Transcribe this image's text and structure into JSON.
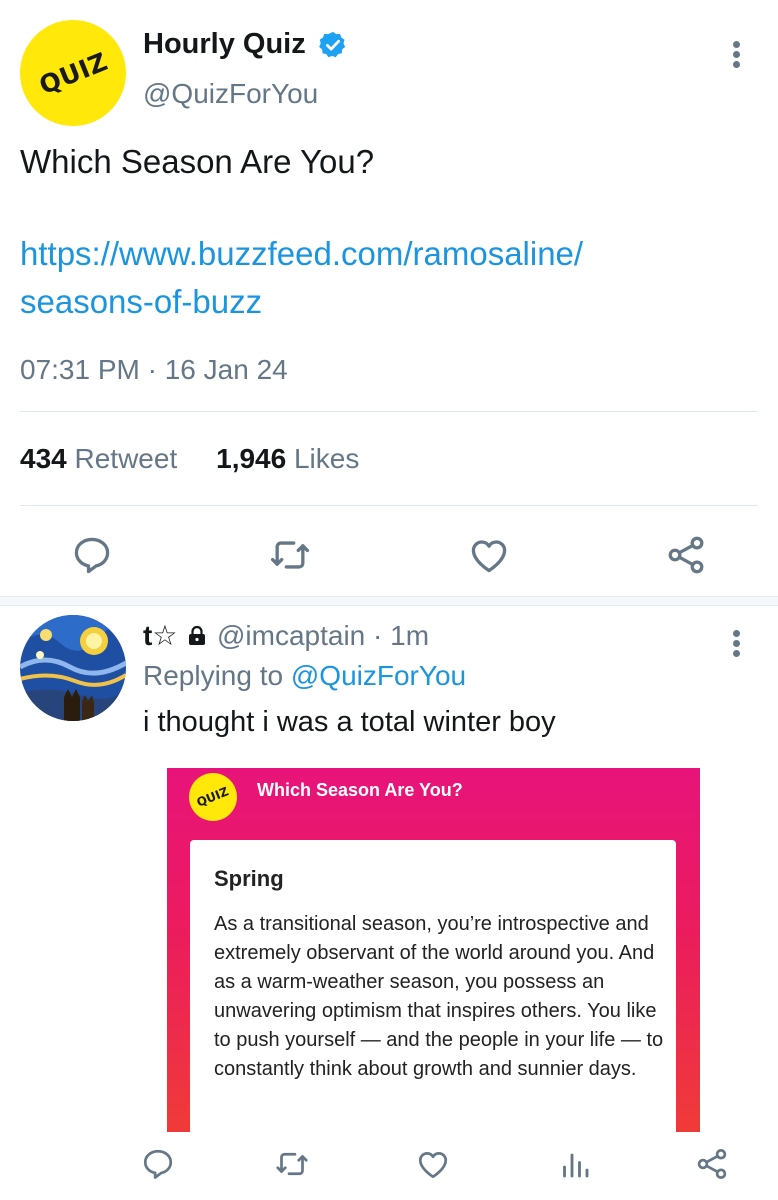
{
  "tweet": {
    "avatar_text": "QUIZ",
    "display_name": "Hourly Quiz",
    "handle": "@QuizForYou",
    "text": "Which Season Are You?",
    "link_line1": "https://www.buzzfeed.com/ramosaline/",
    "link_line2": "seasons-of-buzz",
    "timestamp": "07:31 PM · 16 Jan 24",
    "retweet_count": "434",
    "retweet_label": "Retweet",
    "like_count": "1,946",
    "like_label": "Likes"
  },
  "reply": {
    "name": "t☆",
    "handle": "@imcaptain",
    "time": "· 1m",
    "replying_prefix": "Replying to",
    "replying_handle": "@QuizForYou",
    "text": "i thought i was a total winter boy",
    "card": {
      "logo_text": "QUIZ",
      "title": "Which Season Are You?",
      "result_title": "Spring",
      "result_body": "As a transitional season, you’re introspective and extremely observant of the world around you. And as a warm-weather season, you possess an unwavering optimism that inspires others. You like to push yourself — and the people in your life — to constantly think about growth and sunnier days."
    }
  },
  "colors": {
    "accent": "#1b95e0",
    "muted": "#657786",
    "verified": "#1da1f2",
    "quiz_yellow": "#ffe80a",
    "card_pink": "#e8137a",
    "card_red": "#ef3b38"
  },
  "icons": {
    "actions": [
      "reply-icon",
      "retweet-icon",
      "like-icon",
      "share-icon"
    ],
    "reply_actions": [
      "reply-icon",
      "retweet-icon",
      "like-icon",
      "analytics-icon",
      "share-icon"
    ]
  }
}
